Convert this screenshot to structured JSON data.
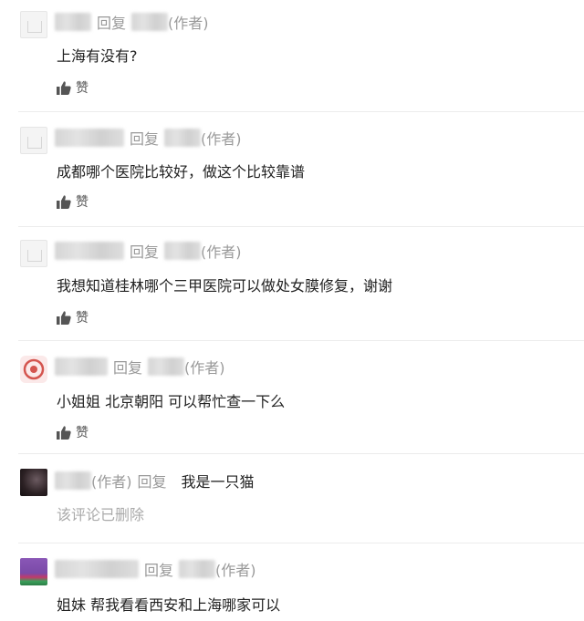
{
  "comments": [
    {
      "reply_label": "回复",
      "author_tag": "(作者)",
      "text": "上海有没有?",
      "like_label": "赞"
    },
    {
      "reply_label": "回复",
      "author_tag": "(作者)",
      "text": "成都哪个医院比较好，做这个比较靠谱",
      "like_label": "赞"
    },
    {
      "reply_label": "回复",
      "author_tag": "(作者)",
      "text": "我想知道桂林哪个三甲医院可以做处女膜修复，谢谢",
      "like_label": "赞"
    },
    {
      "reply_label": "回复",
      "author_tag": "(作者)",
      "text": "小姐姐 北京朝阳 可以帮忙查一下么",
      "like_label": "赞"
    },
    {
      "author_tag": "(作者)",
      "reply_label": "回复",
      "reply_text": "我是一只猫",
      "deleted_text": "该评论已删除"
    },
    {
      "reply_label": "回复",
      "author_tag": "(作者)",
      "text": "姐妹 帮我看看西安和上海哪家可以"
    }
  ],
  "icons": {
    "like": "thumbs-up-icon",
    "like_color": "#555555"
  }
}
